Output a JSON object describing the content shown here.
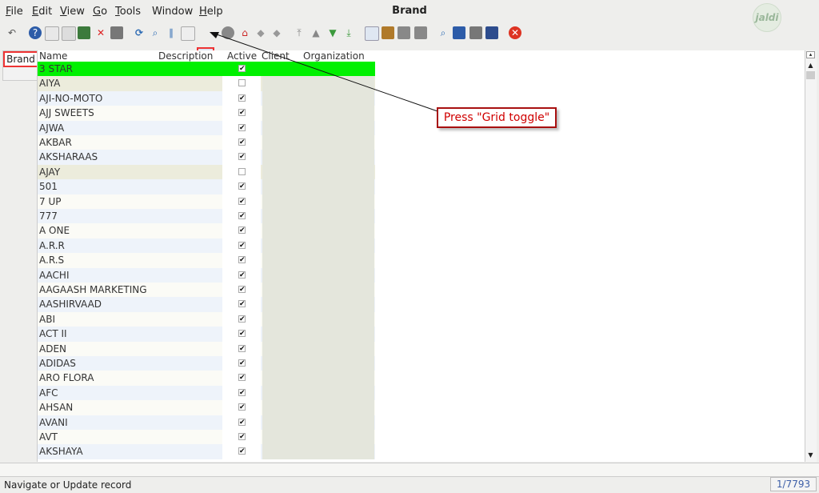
{
  "menu": [
    {
      "accel": "F",
      "rest": "ile"
    },
    {
      "accel": "E",
      "rest": "dit"
    },
    {
      "accel": "V",
      "rest": "iew"
    },
    {
      "accel": "G",
      "rest": "o"
    },
    {
      "accel": "T",
      "rest": "ools"
    },
    {
      "accel": "",
      "rest": "Window"
    },
    {
      "accel": "H",
      "rest": "elp"
    }
  ],
  "window_title": "Brand",
  "logo_text": "jaldi",
  "side_tab": {
    "label": "Brand"
  },
  "grid": {
    "columns": [
      "Name",
      "Description",
      "Active",
      "Client",
      "Organization"
    ],
    "selected_color": "#00f000",
    "rows": [
      {
        "name": "3 STAR",
        "active": true
      },
      {
        "name": "AIYA",
        "active": false
      },
      {
        "name": "AJI-NO-MOTO",
        "active": true
      },
      {
        "name": "AJJ SWEETS",
        "active": true
      },
      {
        "name": "AJWA",
        "active": true
      },
      {
        "name": "AKBAR",
        "active": true
      },
      {
        "name": "AKSHARAAS",
        "active": true
      },
      {
        "name": "AJAY",
        "active": false
      },
      {
        "name": "501",
        "active": true
      },
      {
        "name": "7 UP",
        "active": true
      },
      {
        "name": "777",
        "active": true
      },
      {
        "name": "A ONE",
        "active": true
      },
      {
        "name": "A.R.R",
        "active": true
      },
      {
        "name": "A.R.S",
        "active": true
      },
      {
        "name": "AACHI",
        "active": true
      },
      {
        "name": "AAGAASH MARKETING",
        "active": true
      },
      {
        "name": "AASHIRVAAD",
        "active": true
      },
      {
        "name": "ABI",
        "active": true
      },
      {
        "name": "ACT II",
        "active": true
      },
      {
        "name": "ADEN",
        "active": true
      },
      {
        "name": "ADIDAS",
        "active": true
      },
      {
        "name": "ARO FLORA",
        "active": true
      },
      {
        "name": "AFC",
        "active": true
      },
      {
        "name": "AHSAN",
        "active": true
      },
      {
        "name": "AVANI",
        "active": true
      },
      {
        "name": "AVT",
        "active": true
      },
      {
        "name": "AKSHAYA",
        "active": true
      }
    ]
  },
  "callout_text": "Press \"Grid toggle\"",
  "status": {
    "message": "Navigate or Update record",
    "record": "1/7793"
  }
}
